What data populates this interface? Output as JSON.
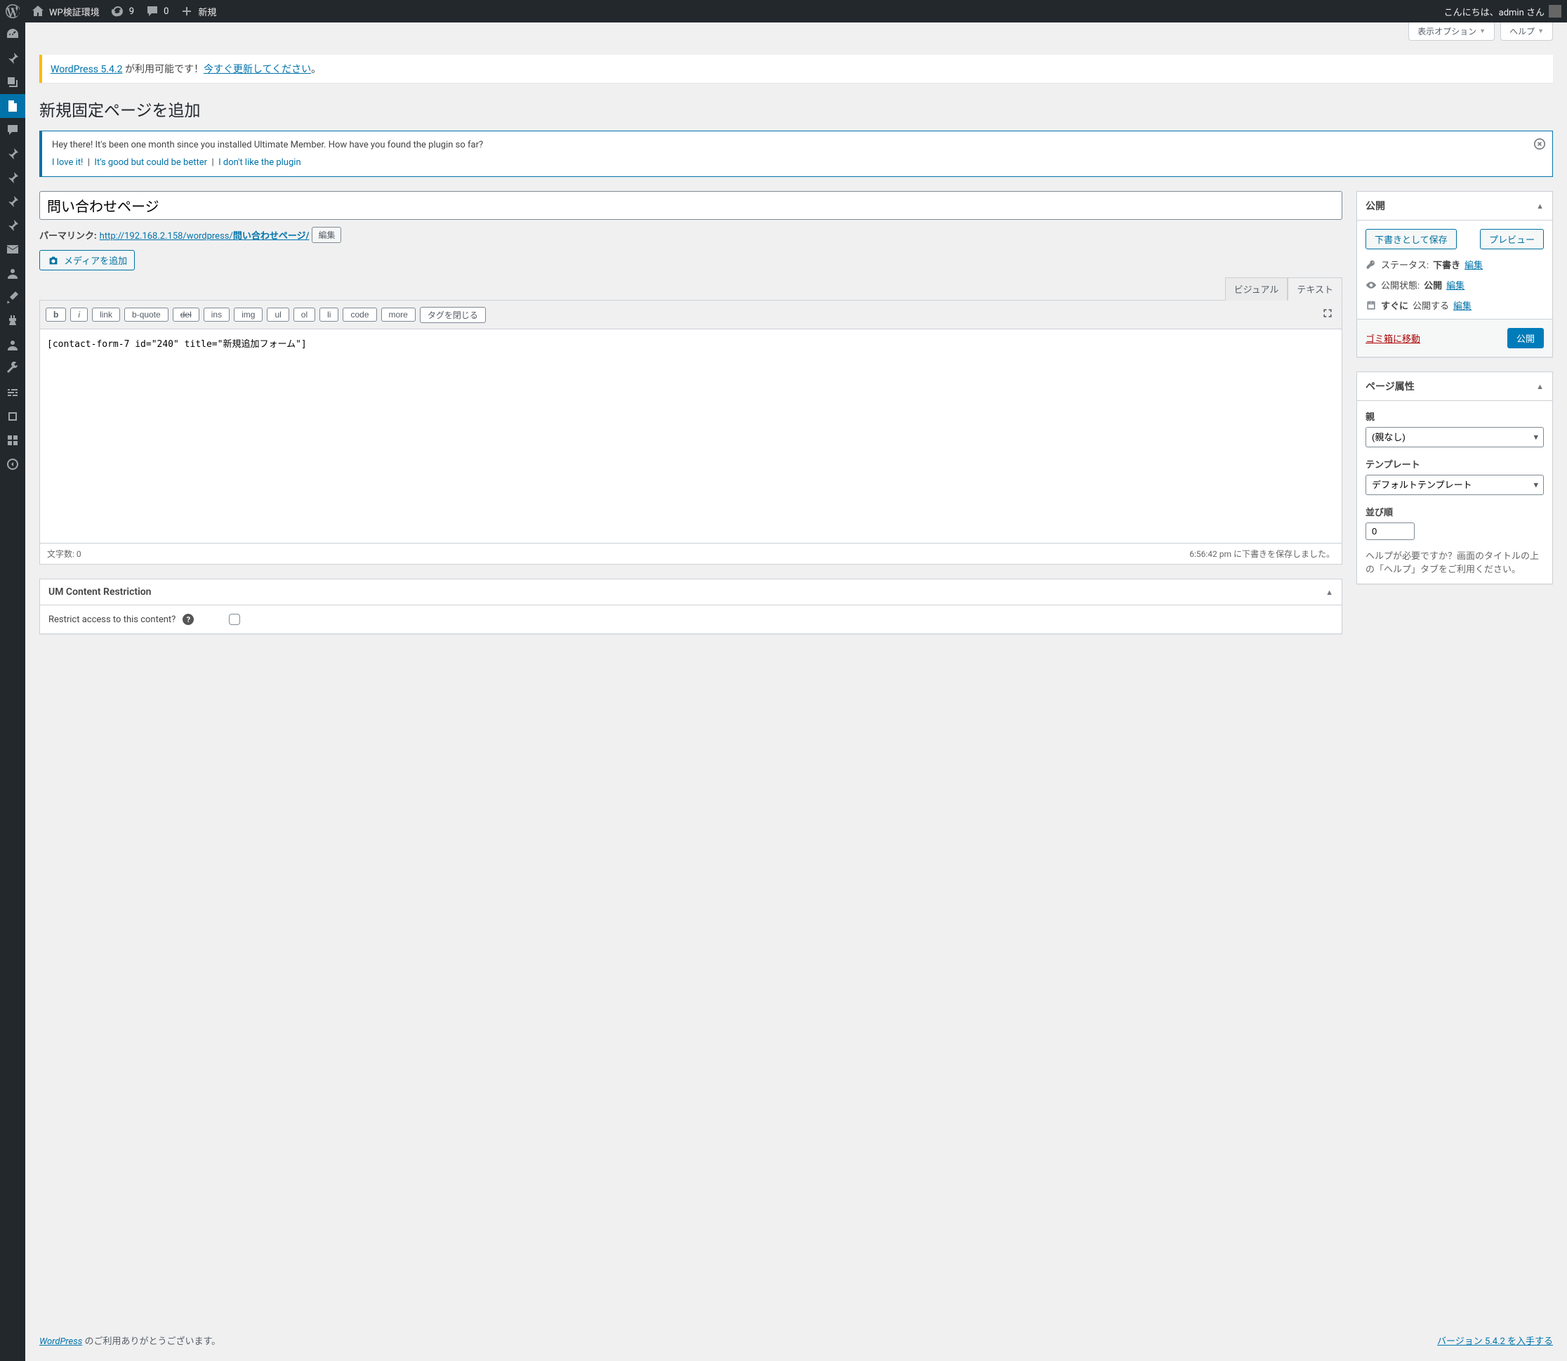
{
  "adminbar": {
    "site_name": "WP検証環境",
    "updates": "9",
    "comments": "0",
    "new": "新規",
    "greeting": "こんにちは、admin さん"
  },
  "screen": {
    "options": "表示オプション",
    "help": "ヘルプ"
  },
  "update_nag": {
    "prefix": "WordPress 5.4.2",
    "mid": " が利用可能です！",
    "link": "今すぐ更新してください",
    "suffix": "。"
  },
  "page_title": "新規固定ページを追加",
  "um_notice": {
    "text": "Hey there! It's been one month since you installed Ultimate Member. How have you found the plugin so far?",
    "love": "I love it!",
    "good": "It's good but could be better",
    "dislike": "I don't like the plugin"
  },
  "title_value": "問い合わせページ",
  "permalink": {
    "label": "パーマリンク:",
    "base": "http://192.168.2.158/wordpress/",
    "slug": "問い合わせページ/",
    "edit": "編集"
  },
  "media_btn": "メディアを追加",
  "tabs": {
    "visual": "ビジュアル",
    "text": "テキスト"
  },
  "toolbar": {
    "b": "b",
    "i": "i",
    "link": "link",
    "bquote": "b-quote",
    "del": "del",
    "ins": "ins",
    "img": "img",
    "ul": "ul",
    "ol": "ol",
    "li": "li",
    "code": "code",
    "more": "more",
    "close": "タグを閉じる"
  },
  "content": "[contact-form-7 id=\"240\" title=\"新規追加フォーム\"]",
  "editor_status": {
    "wordcount_label": "文字数: ",
    "wordcount": "0",
    "saved": "6:56:42 pm に下書きを保存しました。"
  },
  "um_box": {
    "title": "UM Content Restriction",
    "label": "Restrict access to this content?"
  },
  "publish": {
    "title": "公開",
    "save_draft": "下書きとして保存",
    "preview": "プレビュー",
    "status_label": "ステータス:",
    "status_value": "下書き",
    "visibility_label": "公開状態:",
    "visibility_value": "公開",
    "schedule_label": "すぐに",
    "schedule_value": "公開する",
    "edit": "編集",
    "trash": "ゴミ箱に移動",
    "publish_btn": "公開"
  },
  "attrs": {
    "title": "ページ属性",
    "parent_label": "親",
    "parent_value": "(親なし)",
    "template_label": "テンプレート",
    "template_value": "デフォルトテンプレート",
    "order_label": "並び順",
    "order_value": "0",
    "help": "ヘルプが必要ですか？画面のタイトルの上の「ヘルプ」タブをご利用ください。"
  },
  "footer": {
    "wp": "WordPress",
    "thanks": " のご利用ありがとうございます。",
    "version": "バージョン 5.4.2 を入手する"
  }
}
